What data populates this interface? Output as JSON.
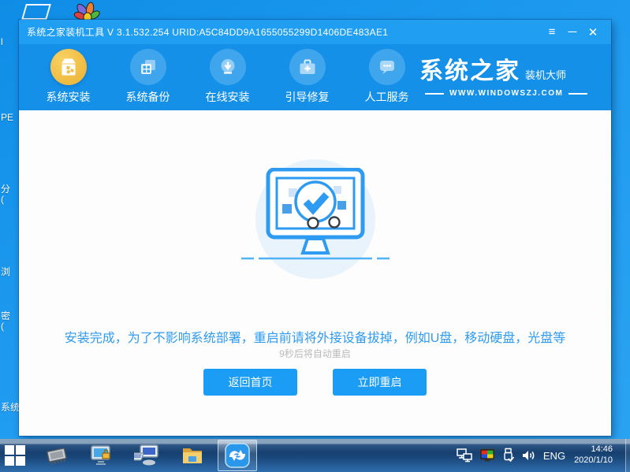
{
  "desktop": {
    "fragments": [
      "l",
      "PE",
      "分",
      "(",
      "浏",
      "密",
      "(",
      "系统"
    ]
  },
  "window": {
    "titlebar": {
      "title": "系统之家装机工具 V 3.1.532.254 URID:A5C84DD9A1655055299D1406DE483AE1",
      "menu_glyph": "≡",
      "minimize_glyph": "─",
      "close_glyph": "✕"
    },
    "nav": {
      "items": [
        {
          "label": "系统安装",
          "icon": "package-icon",
          "active": true
        },
        {
          "label": "系统备份",
          "icon": "backup-copies-icon",
          "active": false
        },
        {
          "label": "在线安装",
          "icon": "download-icon",
          "active": false
        },
        {
          "label": "引导修复",
          "icon": "toolbox-icon",
          "active": false
        },
        {
          "label": "人工服务",
          "icon": "chat-bubble-icon",
          "active": false
        }
      ]
    },
    "logo": {
      "brand": "系统之家",
      "sub": "装机大师",
      "site": "WWW.WINDOWSZJ.COM"
    },
    "main": {
      "message": "安装完成，为了不影响系统部署，重启前请将外接设备拔掉，例如U盘，移动硬盘，光盘等",
      "countdown": "9秒后将自动重启",
      "buttons": [
        {
          "label": "返回首页"
        },
        {
          "label": "立即重启"
        }
      ]
    }
  },
  "taskbar": {
    "tray": {
      "language": "ENG",
      "time": "14:46",
      "date": "2020/1/10"
    }
  },
  "colors": {
    "titlebar_blue": "#1f9ef2",
    "navbar_blue": "#1590e8",
    "accent_blue": "#2f9bef",
    "active_gold": "#eeb93e",
    "taskbar_navy": "#16406f"
  }
}
